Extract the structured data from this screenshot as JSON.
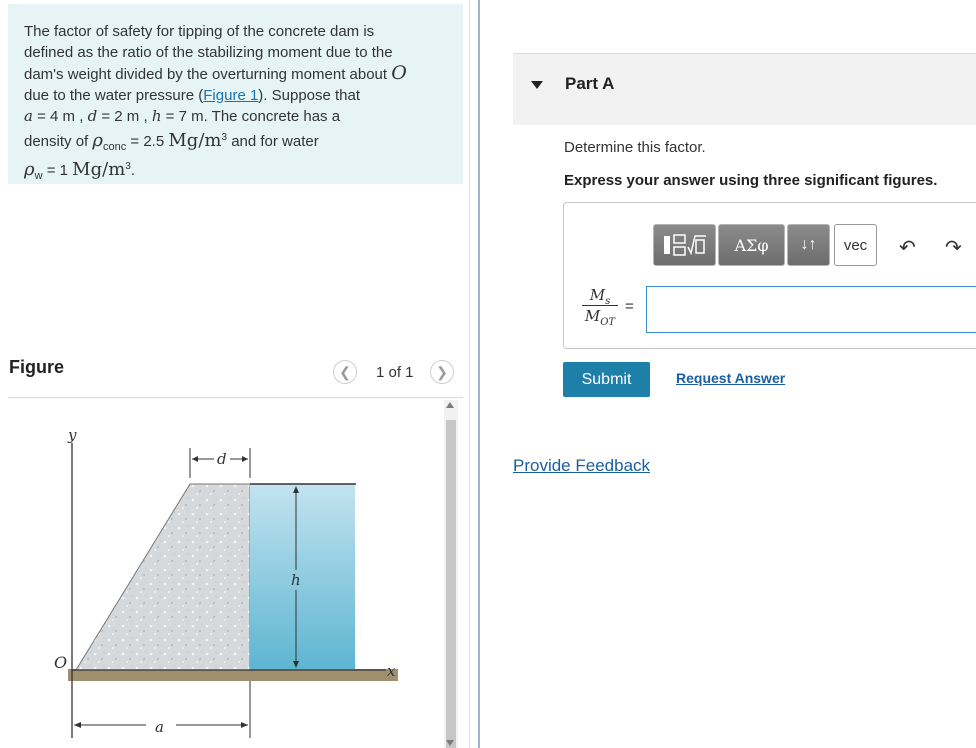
{
  "problem": {
    "line1": "The factor of safety for tipping of the concrete dam is",
    "line2": "defined as the ratio of the stabilizing moment due to the",
    "line3": "dam's weight divided by the overturning moment about",
    "point_O": "O",
    "line4_pre": "due to the water pressure (",
    "figure_link": "Figure 1",
    "line4_post": "). Suppose that",
    "a_var": "a",
    "a_val": "= 4 m",
    "d_var": "d",
    "d_val": "= 2 m",
    "h_var": "h",
    "h_val": "= 7 m",
    "line5_post": ". The concrete has a",
    "density_pre": "density of",
    "rho": "ρ",
    "rho_conc_sub": "conc",
    "rho_conc_val": "= 2.5",
    "unit_mg": "Mg/m",
    "unit_exp": "3",
    "water_text": "and for water",
    "rho_w_sub": "w",
    "rho_w_val": "= 1"
  },
  "figure": {
    "heading": "Figure",
    "pager_text": "1 of 1",
    "prev_icon": "chevron-left-icon",
    "next_icon": "chevron-right-icon",
    "labels": {
      "y": "y",
      "d": "d",
      "h": "h",
      "O": "O",
      "x": "x",
      "a": "a"
    },
    "colors": {
      "concrete": "#d5d8da",
      "water_top": "#bde0ee",
      "water_bottom": "#5fb8d4",
      "ground": "#a08f6e"
    }
  },
  "part": {
    "title": "Part A",
    "caret_icon": "caret-down-icon",
    "instruction": "Determine this factor.",
    "express": "Express your answer using three significant figures.",
    "toolbar": {
      "templates_icon": "templates-icon",
      "greek_label": "ΑΣφ",
      "arrows_label": "↓↑",
      "vec_label": "vec",
      "undo_icon": "undo-icon",
      "redo_icon": "redo-icon"
    },
    "fraction_num": "M",
    "fraction_num_sub": "s",
    "fraction_den": "M",
    "fraction_den_sub": "OT",
    "equals": "=",
    "answer_value": ""
  },
  "actions": {
    "submit": "Submit",
    "request_answer": "Request Answer",
    "feedback": "Provide Feedback"
  },
  "colors": {
    "accent": "#1e7fa8",
    "link": "#1a5fa0",
    "problem_bg": "#e6f4f6"
  }
}
